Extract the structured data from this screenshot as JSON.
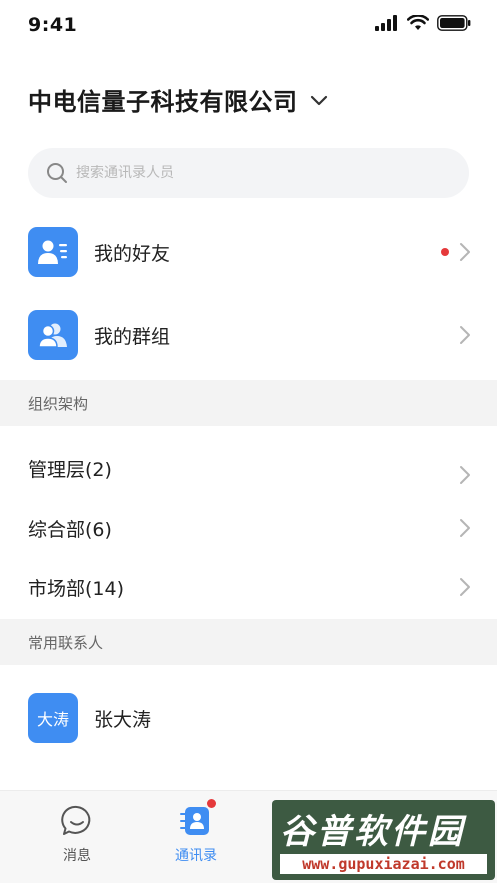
{
  "status_bar": {
    "time": "9:41"
  },
  "header": {
    "company_name": "中电信量子科技有限公司"
  },
  "search": {
    "placeholder": "搜索通讯录人员"
  },
  "quick_items": [
    {
      "label": "我的好友",
      "has_badge": true
    },
    {
      "label": "我的群组",
      "has_badge": false
    }
  ],
  "org_section": {
    "title": "组织架构",
    "departments": [
      {
        "label": "管理层(2)"
      },
      {
        "label": "综合部(6)"
      },
      {
        "label": "市场部(14)"
      }
    ]
  },
  "contacts_section": {
    "title": "常用联系人",
    "contacts": [
      {
        "avatar_text": "大涛",
        "name": "张大涛"
      }
    ]
  },
  "tab_bar": {
    "tabs": [
      {
        "label": "消息",
        "icon": "chat-bubble-icon",
        "active": false
      },
      {
        "label": "通讯录",
        "icon": "contacts-icon",
        "active": true,
        "badge": true
      }
    ]
  },
  "watermark": {
    "title": "谷普软件园",
    "url": "www.gupuxiazai.com"
  },
  "colors": {
    "accent": "#3f8df2",
    "badge": "#e5393b",
    "section_bg": "#f3f3f3"
  }
}
